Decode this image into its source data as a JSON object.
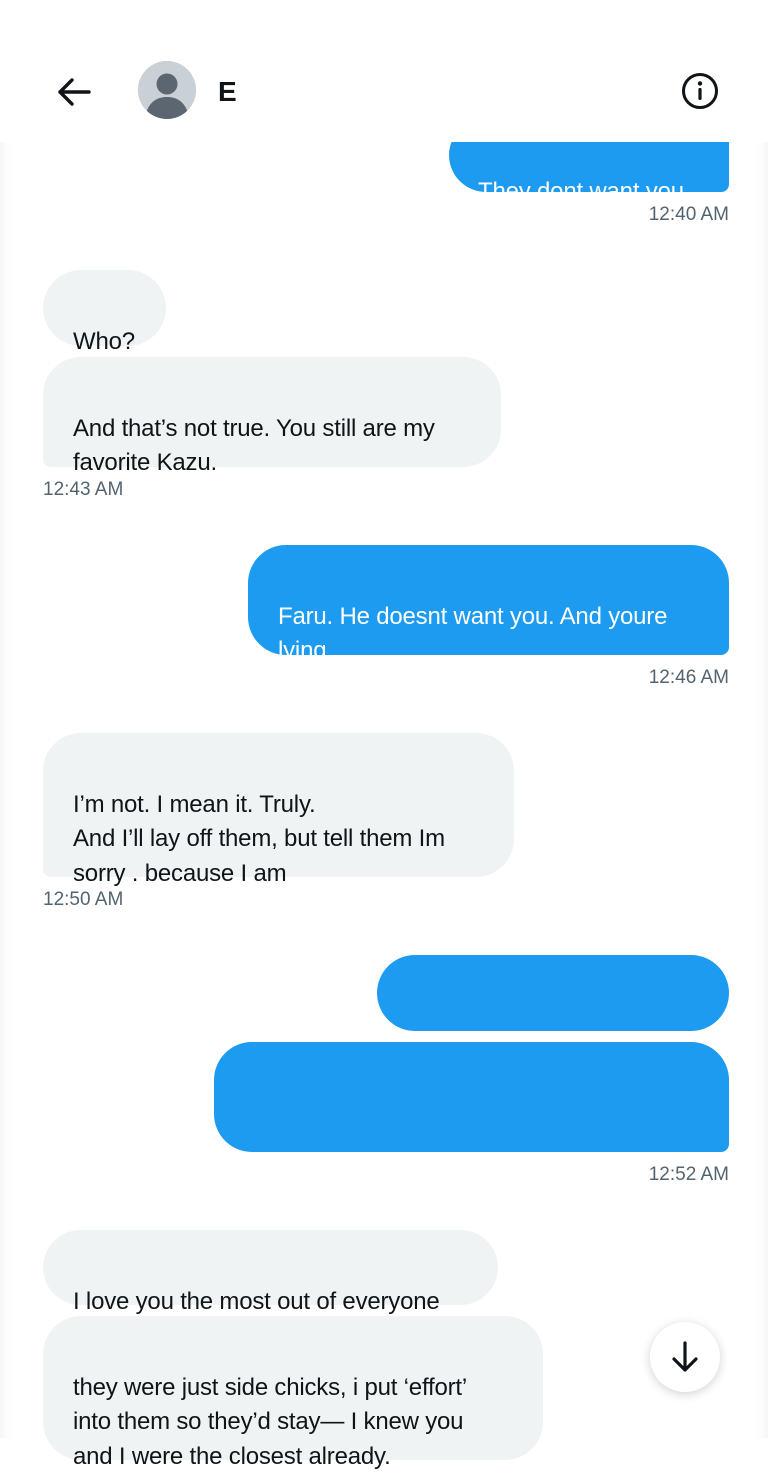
{
  "header": {
    "contact_name": "E",
    "back_icon": "arrow-left-icon",
    "info_icon": "info-circle-icon",
    "avatar_icon": "default-avatar-icon"
  },
  "messages": [
    {
      "sender": "me",
      "text": "They dont want you"
    },
    {
      "sender": "me",
      "timestamp": "12:40 AM"
    },
    {
      "sender": "them",
      "text": "Who?"
    },
    {
      "sender": "them",
      "text": "And that’s not true. You still are my\nfavorite Kazu."
    },
    {
      "sender": "them",
      "timestamp": "12:43 AM"
    },
    {
      "sender": "me",
      "text": "Faru. He doesnt want you. And youre\nlying"
    },
    {
      "sender": "me",
      "timestamp": "12:46 AM"
    },
    {
      "sender": "them",
      "text": "I’m not. I mean it. Truly.\nAnd I’ll lay off them, but tell them Im\nsorry . because I am"
    },
    {
      "sender": "them",
      "timestamp": "12:50 AM"
    },
    {
      "sender": "me",
      "text": ""
    },
    {
      "sender": "me",
      "text": ""
    },
    {
      "sender": "me",
      "timestamp": "12:52 AM"
    },
    {
      "sender": "them",
      "text": "I love you the most out of everyone"
    },
    {
      "sender": "them",
      "text": "they were just side chicks, i put ‘effort’\ninto them so they’d stay— I knew you\nand I were the closest already."
    }
  ],
  "scroll_button": {
    "icon": "arrow-down-icon"
  },
  "colors": {
    "sent_bubble": "#1d9bf0",
    "received_bubble": "#eff3f4",
    "timestamp": "#536471",
    "text": "#0f1419"
  }
}
